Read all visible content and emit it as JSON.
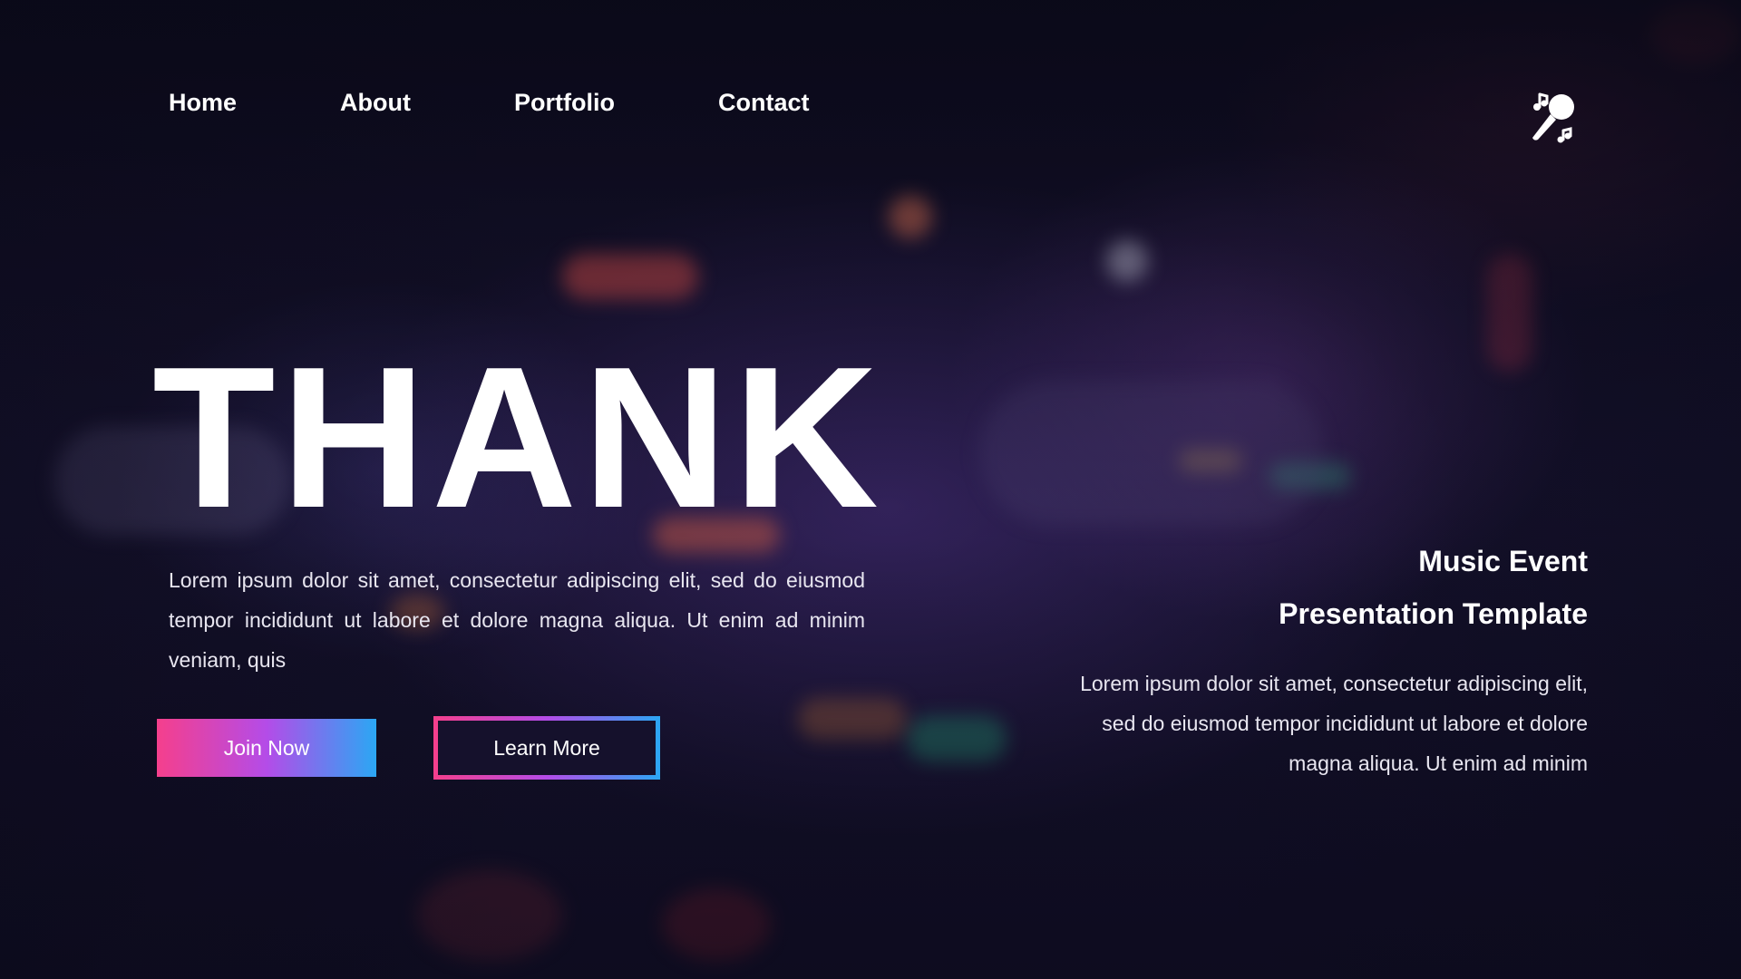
{
  "nav": {
    "items": [
      {
        "label": "Home"
      },
      {
        "label": "About"
      },
      {
        "label": "Portfolio"
      },
      {
        "label": "Contact"
      }
    ]
  },
  "logo": {
    "icon": "microphone-music-icon"
  },
  "hero": {
    "title": "THANK",
    "body": "Lorem ipsum dolor sit amet, consectetur adipiscing elit, sed do eiusmod tempor incididunt ut labore et dolore magna aliqua. Ut enim ad minim veniam, quis",
    "join_label": "Join Now",
    "learn_label": "Learn More"
  },
  "side": {
    "title_line1": "Music Event",
    "title_line2": "Presentation Template",
    "body": "Lorem ipsum dolor sit amet, consectetur adipiscing elit, sed do eiusmod tempor incididunt ut labore et dolore magna aliqua. Ut enim ad minim"
  },
  "colors": {
    "gradient_pink": "#f53f8c",
    "gradient_purple": "#b44ce8",
    "gradient_blue": "#2ba7f4",
    "background": "#0f0d22"
  }
}
